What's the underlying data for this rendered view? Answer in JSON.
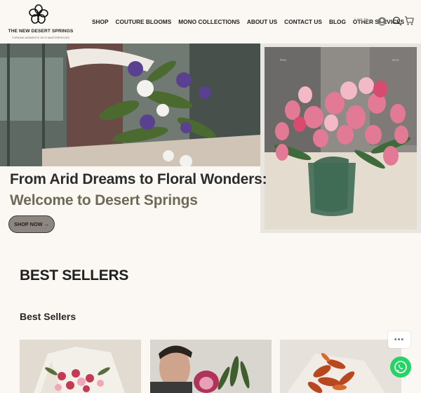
{
  "brand": {
    "name": "THE NEW DESERT SPRINGS",
    "tagline": "TURNING MOMENTS INTO MASTERPIECES"
  },
  "nav": {
    "items": [
      "SHOP",
      "COUTURE BLOOMS",
      "MONO COLLECTIONS",
      "ABOUT US",
      "CONTACT US",
      "BLOG",
      "OTHER SERVICES"
    ],
    "login_label": "Log In",
    "icons": [
      "user-avatar-icon",
      "search-icon",
      "cart-icon"
    ]
  },
  "hero": {
    "headline_line1": "From Arid Dreams to Floral Wonders:",
    "headline_line2": "Welcome to Desert Springs",
    "shop_button": "SHOP NOW →",
    "carousel_prev": "Prev",
    "carousel_next": "Next"
  },
  "best_sellers": {
    "title": "BEST SELLERS",
    "subtitle": "Best Sellers"
  },
  "widgets": {
    "more_label": "•••"
  },
  "colors": {
    "page_bg": "#fbf7f2",
    "headline_dark": "#2c2c2c",
    "headline_olive": "#6f6a58",
    "button_bg": "#8d8680",
    "whatsapp": "#25d366"
  }
}
